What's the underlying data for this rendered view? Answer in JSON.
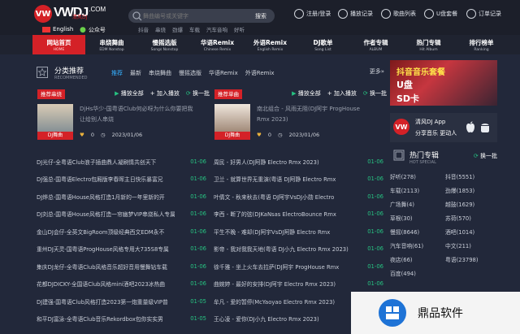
{
  "logo": {
    "mark": "VW",
    "name": "VWDJ",
    "com": ".COM",
    "sub": "清风DJ"
  },
  "lang": {
    "english": "English",
    "wechat": "公众号"
  },
  "search": {
    "placeholder": "舞曲编号或关键字",
    "button": "搜索"
  },
  "hot_keywords": [
    "抖音",
    "串烧",
    "劲爆",
    "车载",
    "汽车音响",
    "好听"
  ],
  "header_links": [
    {
      "label": "注册/登录",
      "icon": "user-icon"
    },
    {
      "label": "播放记录",
      "icon": "history-icon"
    },
    {
      "label": "歌曲列表",
      "icon": "playlist-icon"
    },
    {
      "label": "U盘套餐",
      "icon": "usb-icon"
    },
    {
      "label": "订单记录",
      "icon": "order-icon"
    }
  ],
  "nav": [
    {
      "zh": "网站首页",
      "en": "HOME",
      "active": true
    },
    {
      "zh": "串烧舞曲",
      "en": "EDM Nonstop",
      "active": false
    },
    {
      "zh": "慢摇选版",
      "en": "Songs Nonstop",
      "active": false
    },
    {
      "zh": "华语Remix",
      "en": "Chinese Remix",
      "active": false
    },
    {
      "zh": "外语Remix",
      "en": "English Remix",
      "active": false
    },
    {
      "zh": "DJ歌单",
      "en": "Song List",
      "active": false
    },
    {
      "zh": "作者专辑",
      "en": "ALBUM",
      "active": false
    },
    {
      "zh": "热门专辑",
      "en": "Hit Album",
      "active": false
    },
    {
      "zh": "排行榜单",
      "en": "Ranking",
      "active": false
    }
  ],
  "recommend": {
    "title": "分类推荐",
    "subtitle": "RECOMMENDED",
    "tabs": [
      "推荐",
      "最新",
      "串烧舞曲",
      "慢摇选版",
      "华语Remix",
      "外语Remix"
    ],
    "more": "更多»"
  },
  "actions": {
    "play_all": "播放全部",
    "add_play": "加入播放",
    "refresh": "换一批"
  },
  "left_col": {
    "badge": "推荐串烧",
    "cover_label": "DJ舞曲",
    "feature_title": "DjHs华少-国粤语Club何必呀为什么你要把我让给别人串烧",
    "likes": "0",
    "date": "2023/01/06",
    "rows": [
      {
        "t": "DJ光仔-全粤语Club浪子插曲鼎人凝刷情共创天下",
        "d": "01-06"
      },
      {
        "t": "DJ强总-国粤语Electro包厢版李春晖主日快乐暴富兄",
        "d": "01-06"
      },
      {
        "t": "DJ烨总-国粤语House风格打造1月新的一年里新的开",
        "d": "01-06"
      },
      {
        "t": "DJ刘总-国粤语House风格打造一帘幽梦VIP串烧私人专属",
        "d": "01-06"
      },
      {
        "t": "金山DJ会仔-全英文BigRoom顶级经典西文EDM永不",
        "d": "01-06"
      },
      {
        "t": "重州DJ天灵-国粤语ProgHouse风格专用大735S8专属",
        "d": "01-06"
      },
      {
        "t": "集庆DJ龙仔-全粤语Club风格音乐超好音用慢舞钻车载",
        "d": "01-06"
      },
      {
        "t": "花都DJDICKY-全国语Club风格mini酒吧2023冰热曲",
        "d": "01-06"
      },
      {
        "t": "DJ建强-国粤语Club风格打造2023第一炮重量级VIP普",
        "d": "01-05"
      },
      {
        "t": "和平DJ富泳-全粤语Club音乐Rekordbox包你实实男",
        "d": "01-05"
      },
      {
        "t": "DJ何华-国粤语Club音乐2023全年优秀节目特别奉献",
        "d": "01-05"
      }
    ]
  },
  "right_col": {
    "badge": "推荐单曲",
    "cover_label": "DJ舞曲",
    "feature_title": "南北组合 - 风雨无阻(DJ阿宇 ProgHouse Rmx 2023)",
    "likes": "0",
    "date": "2023/01/06",
    "rows": [
      {
        "t": "周民 - 好男人(DJ阿静 Electro Rmx 2023)",
        "d": "01-06"
      },
      {
        "t": "卫兰 - 就算世界无重演(粤语 DJ阿静 Electro Rmx",
        "d": "01-06"
      },
      {
        "t": "叶倩文 - 秋来秋去(粤语 DJ阿宇VsDJ小勋 Electro",
        "d": "01-06"
      },
      {
        "t": "李西 - 断了的弦(DJKaNsas ElectroBounce Rmx",
        "d": "01-06"
      },
      {
        "t": "平生不晚 - 难却(DJ阿宇VsDJ阿静 Electro Rmx",
        "d": "01-06"
      },
      {
        "t": "影帝 - 我对我我天地(粤语 DJ小九 Electro Rmx 2023)",
        "d": "01-06"
      },
      {
        "t": "徐千雅 - 坐上火车去拉萨(DJ阿宇 ProgHouse Rmx",
        "d": "01-06"
      },
      {
        "t": "曲婉婷 - 最好的安排(DJ阿宇 Electro Rmx 2023)",
        "d": "01-06"
      },
      {
        "t": "牟凡 - 爱的暂停(McYaoyao Electro Rmx 2023)",
        "d": "01-05"
      },
      {
        "t": "王心凌 - 爱你(DJ小九 Electro Rmx 2023)",
        "d": "01-05"
      },
      {
        "t": "陈奕迅 - 苦瓜(DJ阿宇 Electro Rmx 2023)",
        "d": "01-05"
      }
    ]
  },
  "banner": {
    "title": "抖音音乐套餐",
    "u": "U盘",
    "sd": "SD卡"
  },
  "app": {
    "icon": "VW",
    "line1": "清风DJ App",
    "line2": "分享音乐 更动人"
  },
  "hot_special": {
    "title": "热门专辑",
    "subtitle": "HOT SPECIAL",
    "change": "换一批",
    "tags": [
      "好听(278)",
      "抖音(5551)",
      "车载(2113)",
      "劲爆(1853)",
      "广场舞(4)",
      "越鼓(1629)",
      "草根(30)",
      "苏荷(570)",
      "慢摇(8646)",
      "酒吧(1014)",
      "汽车音响(61)",
      "中文(211)",
      "夜店(66)",
      "粤语(23798)",
      "百度(494)"
    ]
  },
  "watermark": {
    "text": "鼎品软件"
  },
  "colors": {
    "accent": "#d42127",
    "date": "#26c281",
    "tab_active": "#35b0ff",
    "like": "#eab13c"
  }
}
